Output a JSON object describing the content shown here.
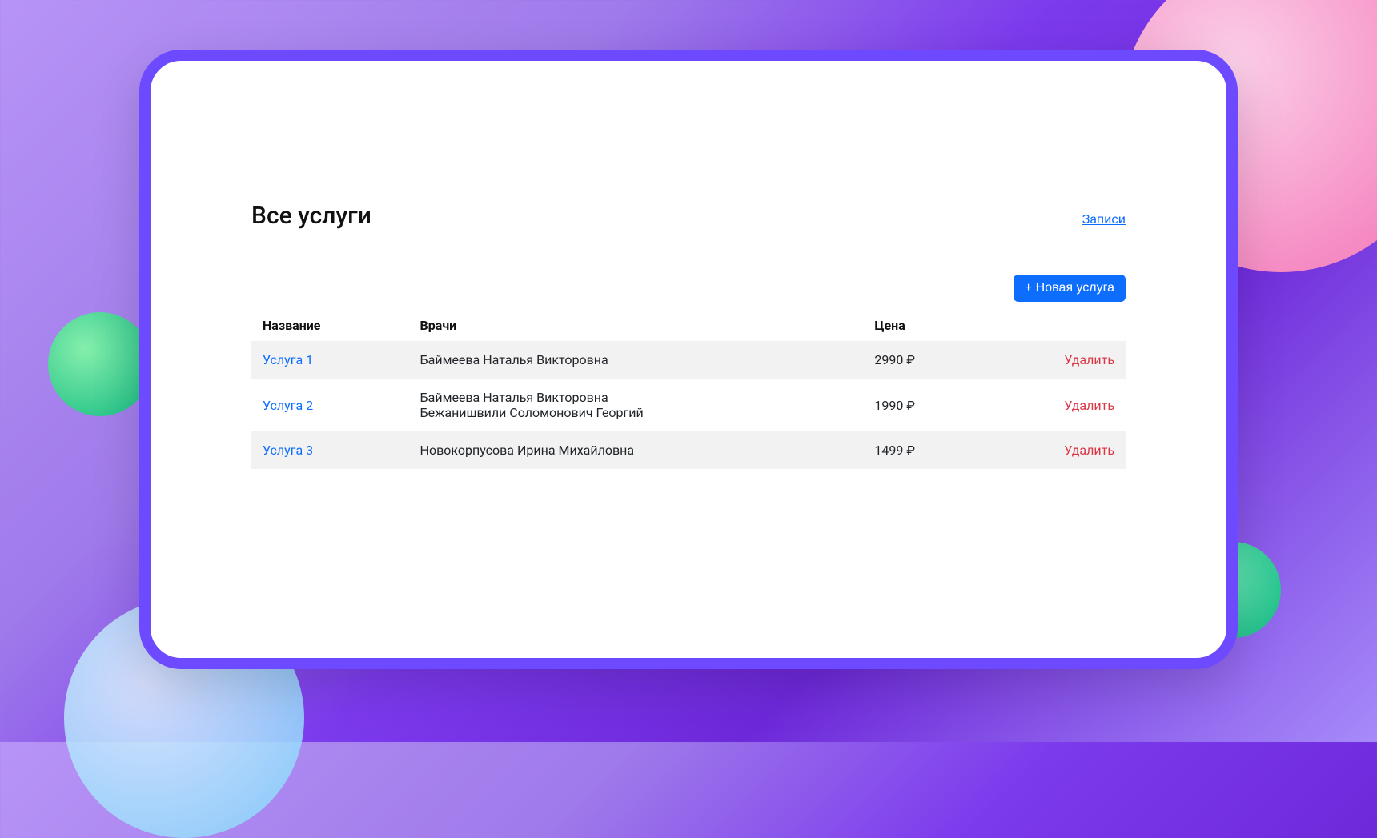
{
  "page": {
    "title": "Все услуги",
    "records_link": "Записи"
  },
  "toolbar": {
    "new_service_label": "+ Новая услуга"
  },
  "table": {
    "headers": {
      "name": "Название",
      "doctors": "Врачи",
      "price": "Цена"
    },
    "rows": [
      {
        "name": "Услуга 1",
        "doctors": [
          "Баймеева Наталья Викторовна"
        ],
        "price": "2990 ₽",
        "delete": "Удалить"
      },
      {
        "name": "Услуга 2",
        "doctors": [
          "Баймеева Наталья Викторовна",
          "Бежанишвили Соломонович Георгий"
        ],
        "price": "1990 ₽",
        "delete": "Удалить"
      },
      {
        "name": "Услуга 3",
        "doctors": [
          "Новокорпусова Ирина Михайловна"
        ],
        "price": "1499 ₽",
        "delete": "Удалить"
      }
    ]
  }
}
